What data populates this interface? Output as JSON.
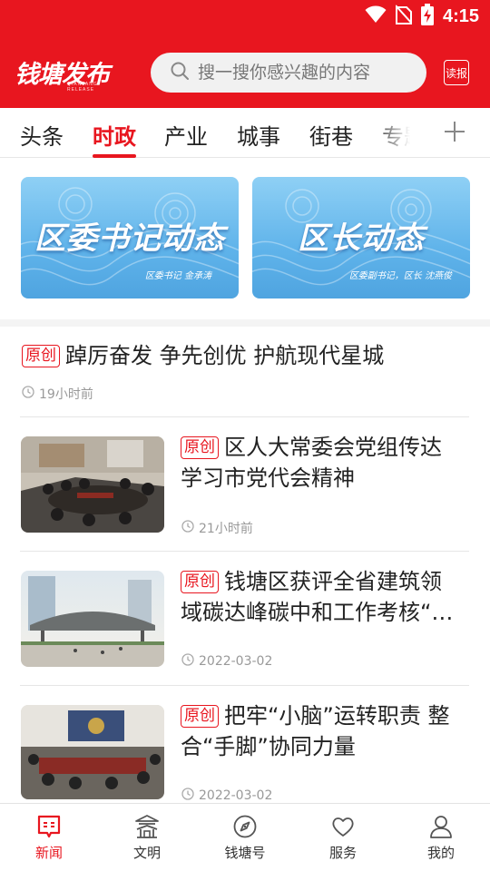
{
  "status_bar": {
    "time": "4:15"
  },
  "header": {
    "logo_text": "钱塘发布",
    "logo_subtext": "QIANTANG RELEASE",
    "search_placeholder": "搜一搜你感兴趣的内容",
    "read_button_label": "读报",
    "brand_color": "#e8161f"
  },
  "tabs": {
    "items": [
      {
        "label": "头条",
        "active": false
      },
      {
        "label": "时政",
        "active": true
      },
      {
        "label": "产业",
        "active": false
      },
      {
        "label": "城事",
        "active": false
      },
      {
        "label": "街巷",
        "active": false
      },
      {
        "label": "专题",
        "active": false
      }
    ],
    "add_icon": "plus-icon"
  },
  "banners": [
    {
      "title": "区委书记动态",
      "subtitle": "区委书记  金承涛"
    },
    {
      "title": "区长动态",
      "subtitle": "区委副书记，区长  沈燕俊"
    }
  ],
  "news": {
    "headline": {
      "badge": "原创",
      "title": "踔厉奋发 争先创优 护航现代星城",
      "time": "19小时前"
    },
    "items": [
      {
        "badge": "原创",
        "title": "区人大常委会党组传达学习市党代会精神",
        "time": "21小时前"
      },
      {
        "badge": "原创",
        "title": "钱塘区获评全省建筑领域碳达峰碳中和工作考核“…",
        "time": "2022-03-02"
      },
      {
        "badge": "原创",
        "title": "把牢“小脑”运转职责 整合“手脚”协同力量",
        "time": "2022-03-02"
      }
    ]
  },
  "bottom_nav": {
    "items": [
      {
        "label": "新闻",
        "icon": "news-icon",
        "active": true
      },
      {
        "label": "文明",
        "icon": "pavilion-icon",
        "active": false
      },
      {
        "label": "钱塘号",
        "icon": "compass-icon",
        "active": false
      },
      {
        "label": "服务",
        "icon": "heart-icon",
        "active": false
      },
      {
        "label": "我的",
        "icon": "profile-icon",
        "active": false
      }
    ]
  }
}
